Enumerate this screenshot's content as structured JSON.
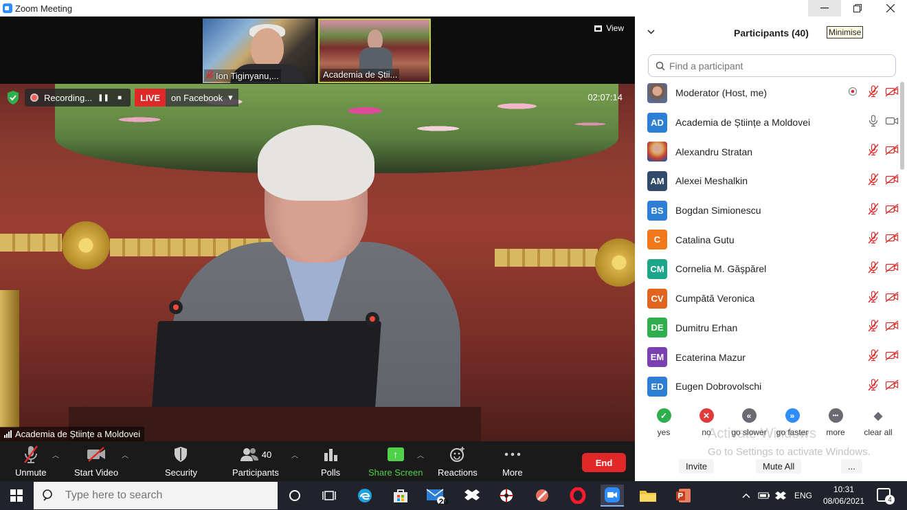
{
  "window": {
    "title": "Zoom Meeting",
    "minimize_icon": "minimize-icon",
    "restore_icon": "restore-icon",
    "close_icon": "close-icon"
  },
  "thumbnails": [
    {
      "name": "Ion Tiginyanu,...",
      "muted": true
    },
    {
      "name": "Academia de Știi...",
      "muted": false,
      "active": true
    }
  ],
  "view_button": {
    "label": "View"
  },
  "recording": {
    "label": "Recording..."
  },
  "live": {
    "badge": "LIVE",
    "destination": "on Facebook"
  },
  "timer": "02:07:14",
  "active_speaker": "Academia de Științe a Moldovei",
  "toolbar": {
    "unmute": "Unmute",
    "start_video": "Start Video",
    "security": "Security",
    "participants": "Participants",
    "participants_count": "40",
    "polls": "Polls",
    "share_screen": "Share Screen",
    "reactions": "Reactions",
    "more": "More",
    "end": "End",
    "share_color": "#4fd14a",
    "end_color": "#e02828"
  },
  "panel": {
    "title": "Participants (40)",
    "minimise": "Minimise",
    "search_placeholder": "Find a participant",
    "participants": [
      {
        "initials": "",
        "name": "Moderator (Host, me)",
        "avatar": "photo",
        "audio": "muted",
        "video": "off",
        "extra": "record-icon"
      },
      {
        "initials": "AD",
        "name": "Academia de Științe a Moldovei",
        "color": "#2d7fd6",
        "audio": "on",
        "video": "on"
      },
      {
        "initials": "",
        "name": "Alexandru Stratan",
        "avatar": "photo2",
        "audio": "muted",
        "video": "off"
      },
      {
        "initials": "AM",
        "name": "Alexei Meshalkin",
        "color": "#2f4a6b",
        "audio": "muted",
        "video": "off"
      },
      {
        "initials": "BS",
        "name": "Bogdan Simionescu",
        "color": "#2d7fd6",
        "audio": "muted",
        "video": "off"
      },
      {
        "initials": "C",
        "name": "Catalina Gutu",
        "color": "#f07818",
        "audio": "muted",
        "video": "off"
      },
      {
        "initials": "CM",
        "name": "Cornelia M. Gășpărel",
        "color": "#1ba68a",
        "audio": "muted",
        "video": "off"
      },
      {
        "initials": "CV",
        "name": "Cumpătă Veronica",
        "color": "#e0631e",
        "audio": "muted",
        "video": "off"
      },
      {
        "initials": "DE",
        "name": "Dumitru Erhan",
        "color": "#2fae4e",
        "audio": "muted",
        "video": "off"
      },
      {
        "initials": "EM",
        "name": "Ecaterina Mazur",
        "color": "#7a3fb0",
        "audio": "muted",
        "video": "off"
      },
      {
        "initials": "ED",
        "name": "Eugen Dobrovolschi",
        "color": "#2d7fd6",
        "audio": "muted",
        "video": "off"
      }
    ],
    "reactions": [
      {
        "label": "yes",
        "color": "#2fae4e",
        "glyph": "✓"
      },
      {
        "label": "no",
        "color": "#e03a3a",
        "glyph": "✕"
      },
      {
        "label": "go slower",
        "color": "#6a6a72",
        "glyph": "«"
      },
      {
        "label": "go faster",
        "color": "#2d8cff",
        "glyph": "»"
      },
      {
        "label": "more",
        "color": "#6a6a72",
        "glyph": "•••"
      },
      {
        "label": "clear all",
        "color": "#6a6a72",
        "glyph": "◆"
      }
    ],
    "watermark_line1": "Activate Windows",
    "watermark_line2": "Go to Settings to activate Windows.",
    "invite": "Invite",
    "mute_all": "Mute All",
    "more": "..."
  },
  "taskbar": {
    "search_placeholder": "Type here to search",
    "mail_badge": "20",
    "lang": "ENG",
    "time": "10:31",
    "date": "08/06/2021",
    "notifications": "4"
  }
}
